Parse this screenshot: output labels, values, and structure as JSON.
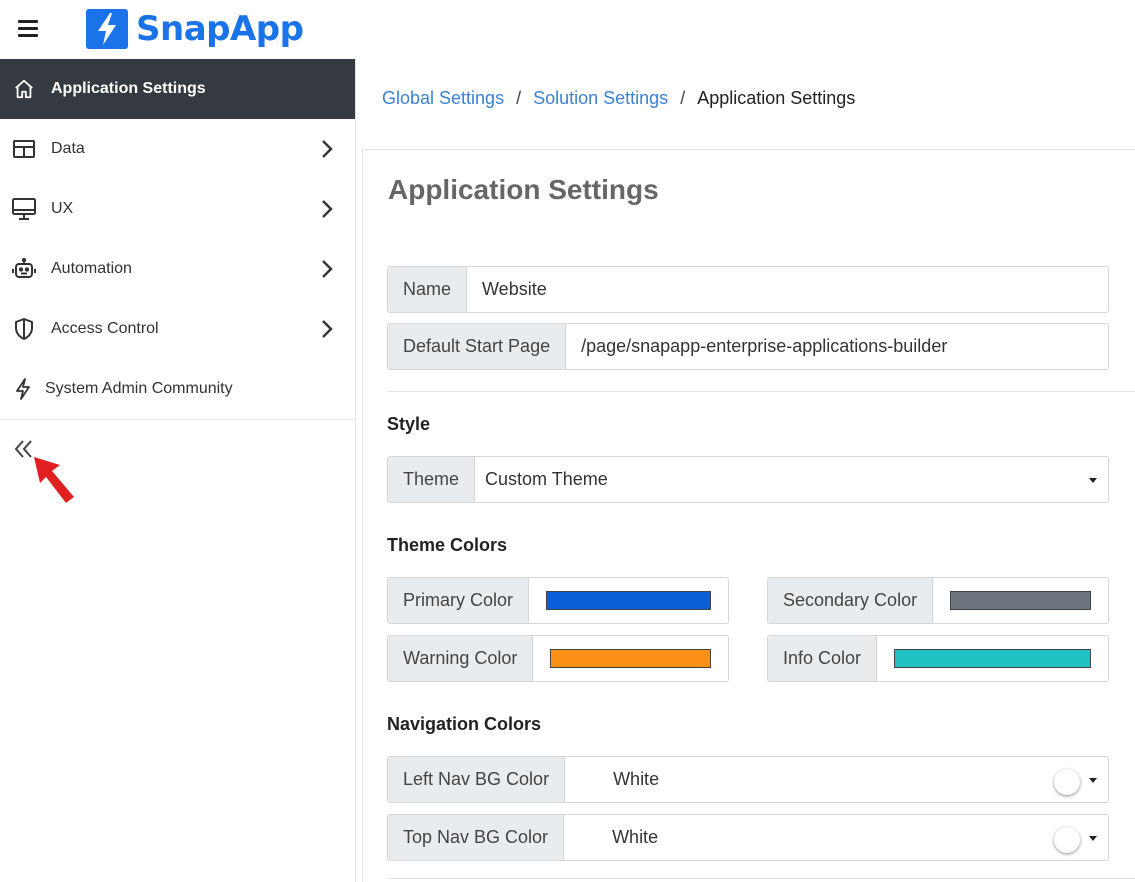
{
  "app": {
    "name": "SnapApp"
  },
  "sidebar": {
    "items": [
      {
        "label": "Application Settings",
        "icon": "home-icon",
        "active": true,
        "has_children": false
      },
      {
        "label": "Data",
        "icon": "table-icon",
        "active": false,
        "has_children": true
      },
      {
        "label": "UX",
        "icon": "monitor-icon",
        "active": false,
        "has_children": true
      },
      {
        "label": "Automation",
        "icon": "robot-icon",
        "active": false,
        "has_children": true
      },
      {
        "label": "Access Control",
        "icon": "shield-icon",
        "active": false,
        "has_children": true
      },
      {
        "label": "System Admin Community",
        "icon": "bolt-icon",
        "active": false,
        "has_children": false
      }
    ],
    "collapse_icon": "double-chevron-left-icon"
  },
  "breadcrumb": {
    "items": [
      "Global Settings",
      "Solution Settings"
    ],
    "separator": "/",
    "current": "Application Settings"
  },
  "page": {
    "title": "Application Settings"
  },
  "general": {
    "name_label": "Name",
    "name_value": "Website",
    "start_page_label": "Default Start Page",
    "start_page_value": "/page/snapapp-enterprise-applications-builder"
  },
  "style": {
    "title": "Style",
    "theme_label": "Theme",
    "theme_value": "Custom Theme"
  },
  "theme_colors": {
    "title": "Theme Colors",
    "primary_label": "Primary Color",
    "primary_color": "#0a5fd9",
    "secondary_label": "Secondary Color",
    "secondary_color": "#6c757d",
    "warning_label": "Warning Color",
    "warning_color": "#fd9017",
    "info_label": "Info Color",
    "info_color": "#22c1c3"
  },
  "navigation_colors": {
    "title": "Navigation Colors",
    "left_nav_label": "Left Nav BG Color",
    "left_nav_value": "White",
    "top_nav_label": "Top Nav BG Color",
    "top_nav_value": "White"
  },
  "colors": {
    "accent": "#1a73e8",
    "active_nav_bg": "#343a40",
    "link": "#3b82d6",
    "annotation_arrow": "#e02020"
  }
}
